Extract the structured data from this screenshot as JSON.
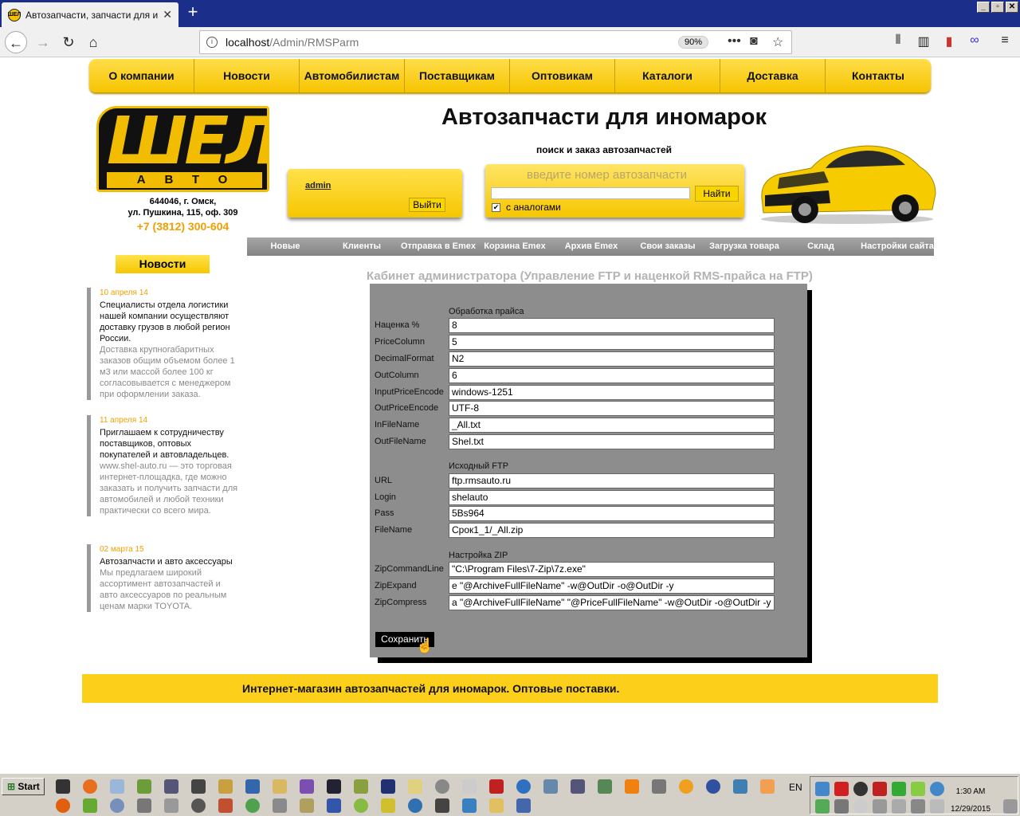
{
  "browser": {
    "tab_title": "Автозапчасти, запчасти для ино",
    "url_host": "localhost",
    "url_path": "/Admin/RMSParm",
    "zoom": "90%"
  },
  "topmenu": [
    "О компании",
    "Новости",
    "Автомобилистам",
    "Поставщикам",
    "Оптовикам",
    "Каталоги",
    "Доставка",
    "Контакты"
  ],
  "logo": {
    "big": "ШЕЛ",
    "small": "АВТО"
  },
  "address": {
    "line1": "644046, г. Омск,",
    "line2": "ул. Пушкина, 115, оф. 309",
    "phone": "+7 (3812) 300-604"
  },
  "header": {
    "title": "Автозапчасти для иномарок",
    "subtitle": "поиск и заказ автозапчастей"
  },
  "login": {
    "user": "admin",
    "logout": "Выйти"
  },
  "search": {
    "placeholder": "введите номер автозапчасти",
    "button": "Найти",
    "analogs": "с аналогами"
  },
  "adminmenu": [
    "Новые",
    "Клиенты",
    "Отправка в Emex",
    "Корзина Emex",
    "Архив Emex",
    "Свои заказы",
    "Загрузка товара",
    "Склад",
    "Настройки сайта"
  ],
  "news_button": "Новости",
  "news": [
    {
      "date": "10 апреля 14",
      "head": "Специалисты отдела логистики нашей компании осуществляют доставку грузов в любой регион России.",
      "body": "Доставка крупногабаритных заказов общим объемом более 1 м3 или массой более 100 кг согласовывается с менеджером при оформлении заказа."
    },
    {
      "date": "11 апреля 14",
      "head": "Приглашаем к сотрудничеству поставщиков, оптовых покупателей и автовладельцев.",
      "body": "www.shel-auto.ru — это торговая интернет-площадка, где можно заказать и получить запчасти для автомобилей и любой техники практически со всего мира."
    },
    {
      "date": "02 марта 15",
      "head": "Автозапчасти и авто аксессуары",
      "body": "Мы предлагаем широкий ассортимент автозапчастей и авто аксессуаров по реальным ценам марки TOYOTA."
    }
  ],
  "page_title": "Кабинет администратора (Управление FTP и наценкой RMS-прайса на FTP)",
  "form": {
    "sections": [
      {
        "title": "Обработка прайса",
        "fields": [
          {
            "label": "Наценка %",
            "value": "8"
          },
          {
            "label": "PriceColumn",
            "value": "5"
          },
          {
            "label": "DecimalFormat",
            "value": "N2"
          },
          {
            "label": "OutColumn",
            "value": "6"
          },
          {
            "label": "InputPriceEncode",
            "value": "windows-1251"
          },
          {
            "label": "OutPriceEncode",
            "value": "UTF-8"
          },
          {
            "label": "InFileName",
            "value": "_All.txt"
          },
          {
            "label": "OutFileName",
            "value": "Shel.txt"
          }
        ]
      },
      {
        "title": "Исходный FTP",
        "fields": [
          {
            "label": "URL",
            "value": "ftp.rmsauto.ru"
          },
          {
            "label": "Login",
            "value": "shelauto"
          },
          {
            "label": "Pass",
            "value": "5Bs964"
          },
          {
            "label": "FileName",
            "value": "Срок1_1/_All.zip"
          }
        ]
      },
      {
        "title": "Настройка ZIP",
        "fields": [
          {
            "label": "ZipCommandLine",
            "value": "\"C:\\Program Files\\7-Zip\\7z.exe\""
          },
          {
            "label": "ZipExpand",
            "value": " e \"@ArchiveFullFileName\" -w@OutDir -o@OutDir -y"
          },
          {
            "label": "ZipCompress",
            "value": " a \"@ArchiveFullFileName\" \"@PriceFullFileName\" -w@OutDir -o@OutDir -y"
          }
        ]
      }
    ],
    "save": "Сохранить"
  },
  "footer": "Интернет-магазин автозапчастей для иномарок. Оптовые поставки.",
  "taskbar": {
    "start": "Start",
    "lang": "EN",
    "time": "1:30 AM",
    "date": "12/29/2015"
  },
  "colors": {
    "accent": "#f6c600",
    "panel": "#8d8d8d",
    "date": "#f0a000"
  }
}
